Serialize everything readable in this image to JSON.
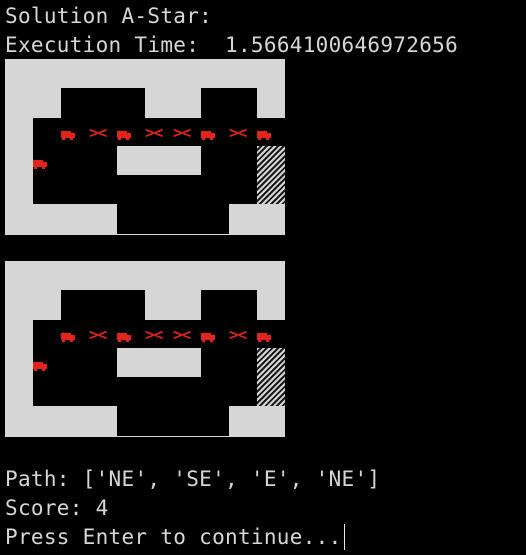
{
  "console": {
    "title_line": "Solution A-Star:",
    "exec_label": "Execution Time:",
    "exec_value": "1.5664100646972656",
    "path_label": "Path:",
    "path_value": "['NE', 'SE', 'E', 'NE']",
    "score_label": "Score:",
    "score_value": "4",
    "prompt": "Press Enter to continue..."
  },
  "boards": [
    {
      "arrow_glyph": "><"
    },
    {
      "arrow_glyph": "><"
    }
  ],
  "colors": {
    "background": "#000000",
    "wall": "#d6d6d6",
    "path_marker": "#e3241b",
    "text": "#d6d6d6"
  },
  "icons": {
    "vehicle": "truck-icon",
    "goal": "hatched-goal-cell",
    "arrow": "direction-arrows"
  }
}
